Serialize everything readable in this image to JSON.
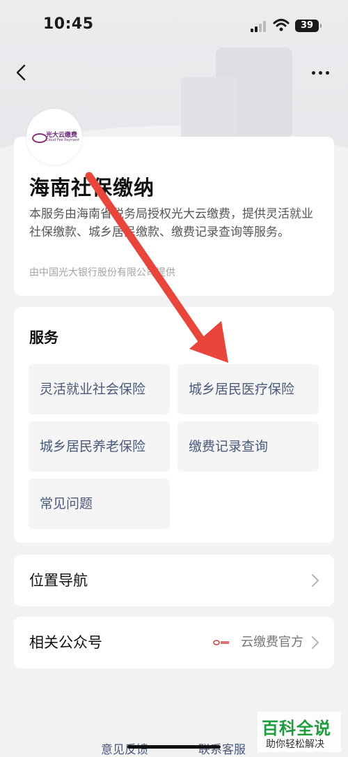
{
  "status_bar": {
    "time": "10:45",
    "battery": "39"
  },
  "info": {
    "title": "海南社保缴纳",
    "description": "本服务由海南省税务局授权光大云缴费，提供灵活就业社保缴款、城乡居民缴款、缴费记录查询等服务。",
    "provider": "由中国光大银行股份有限公司提供",
    "logo_text": "光大云缴费",
    "logo_sub": "Cloud Fee Payment"
  },
  "services": {
    "title": "服务",
    "items": [
      {
        "label": "灵活就业社会保险"
      },
      {
        "label": "城乡居民医疗保险"
      },
      {
        "label": "城乡居民养老保险"
      },
      {
        "label": "缴费记录查询"
      },
      {
        "label": "常见问题"
      }
    ]
  },
  "rows": {
    "navigation": {
      "label": "位置导航"
    },
    "official_account": {
      "label": "相关公众号",
      "value": "云缴费官方"
    }
  },
  "footer": {
    "feedback": "意见反馈",
    "contact": "联系客服"
  },
  "watermark": {
    "main": "百科全说",
    "sub": "助你轻松解决"
  },
  "colors": {
    "accent": "#4a5a7a",
    "arrow": "#e8463a",
    "watermark": "#1e9c3e"
  }
}
